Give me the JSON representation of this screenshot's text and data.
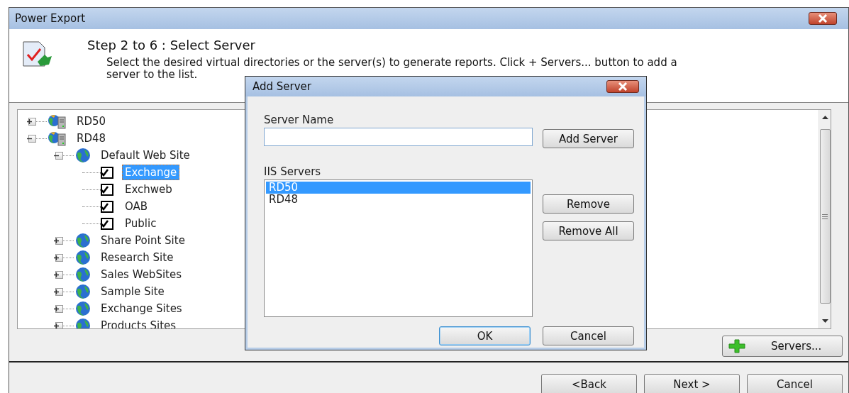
{
  "window": {
    "title": "Power Export"
  },
  "header": {
    "step_title": "Step 2 to 6 : Select Server",
    "description": "Select the desired virtual directories or the server(s) to generate reports. Click + Servers... button to add a server to the list."
  },
  "tree": [
    {
      "label": "RD50",
      "kind": "server",
      "expanded": false
    },
    {
      "label": "RD48",
      "kind": "server",
      "expanded": true,
      "children": [
        {
          "label": "Default Web Site",
          "kind": "site",
          "expanded": true,
          "children": [
            {
              "label": "Exchange",
              "kind": "directory",
              "checked": true,
              "selected": true
            },
            {
              "label": "Exchweb",
              "kind": "directory",
              "checked": true,
              "selected": false
            },
            {
              "label": "OAB",
              "kind": "directory",
              "checked": true,
              "selected": false
            },
            {
              "label": "Public",
              "kind": "directory",
              "checked": true,
              "selected": false
            }
          ]
        },
        {
          "label": "Share Point Site",
          "kind": "site",
          "expanded": false
        },
        {
          "label": "Research Site",
          "kind": "site",
          "expanded": false
        },
        {
          "label": "Sales WebSites",
          "kind": "site",
          "expanded": false
        },
        {
          "label": "Sample Site",
          "kind": "site",
          "expanded": false
        },
        {
          "label": "Exchange Sites",
          "kind": "site",
          "expanded": false
        },
        {
          "label": "Products Sites",
          "kind": "site",
          "expanded": false
        }
      ]
    }
  ],
  "servers_button": {
    "label": "Servers..."
  },
  "nav_buttons": [
    {
      "label": "<Back"
    },
    {
      "label": "Next >"
    },
    {
      "label": "Cancel"
    }
  ],
  "dialog": {
    "title": "Add Server",
    "server_name_label": "Server Name",
    "add_button": "Add Server",
    "list_label": "IIS Servers",
    "list_items": [
      {
        "label": "RD50",
        "selected": true
      },
      {
        "label": "RD48",
        "selected": false
      }
    ],
    "side_buttons": [
      "Remove",
      "Remove All"
    ],
    "footer_buttons": [
      {
        "label": "OK",
        "default": true
      },
      {
        "label": "Cancel",
        "default": false
      }
    ]
  }
}
